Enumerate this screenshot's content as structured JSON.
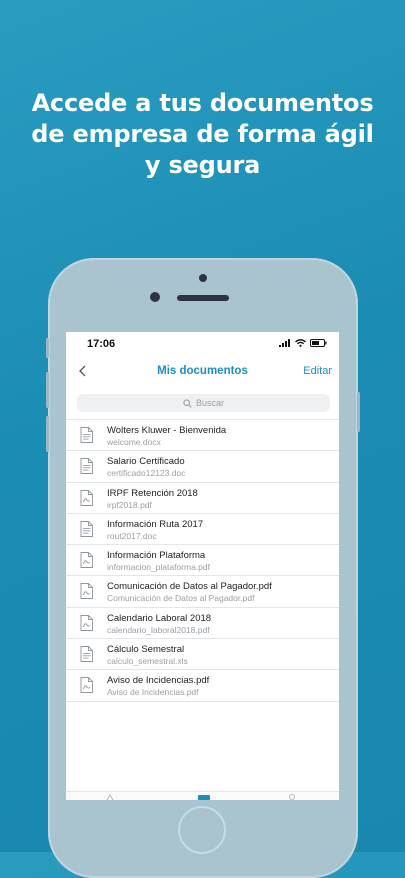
{
  "headline": {
    "line1": "Accede a tus documentos",
    "line2": "de empresa de forma ágil",
    "line3": "y segura"
  },
  "status": {
    "time": "17:06"
  },
  "nav": {
    "title": "Mis documentos",
    "edit_label": "Editar"
  },
  "search": {
    "placeholder": "Buscar",
    "icon": "search-icon"
  },
  "documents": [
    {
      "title": "Wolters Kluwer - Bienvenida",
      "file": "welcome.docx",
      "icon": "document-icon"
    },
    {
      "title": "Salario Certificado",
      "file": "certificado12123.doc",
      "icon": "document-icon"
    },
    {
      "title": "IRPF Retención 2018",
      "file": "irpf2018.pdf",
      "icon": "pdf-icon"
    },
    {
      "title": "Información Ruta 2017",
      "file": "rout2017.doc",
      "icon": "document-icon"
    },
    {
      "title": "Información Plataforma",
      "file": "informacion_plataforma.pdf",
      "icon": "pdf-icon"
    },
    {
      "title": "Comunicación de Datos al Pagador.pdf",
      "file": "Comunicación de Datos al Pagador.pdf",
      "icon": "pdf-icon"
    },
    {
      "title": "Calendario Laboral 2018",
      "file": "calendario_laboral2018.pdf",
      "icon": "pdf-icon"
    },
    {
      "title": "Cálculo Semestral",
      "file": "calculo_semestral.xls",
      "icon": "document-icon"
    },
    {
      "title": "Aviso de Incidencias.pdf",
      "file": "Aviso de Incidencias.pdf",
      "icon": "pdf-icon"
    }
  ],
  "colors": {
    "background": "#1b8cb4",
    "accent": "#1f8cbf",
    "phone_body": "#a9c4cf"
  }
}
